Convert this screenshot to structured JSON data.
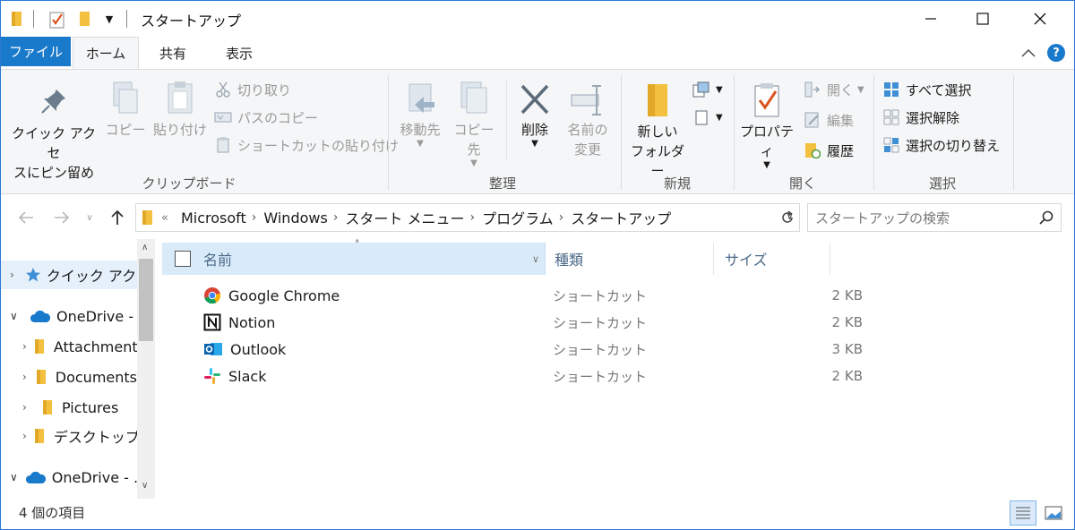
{
  "window": {
    "title": "スタートアップ"
  },
  "tabs": {
    "file": "ファイル",
    "home": "ホーム",
    "share": "共有",
    "view": "表示"
  },
  "ribbon": {
    "clipboard": {
      "label": "クリップボード",
      "pin_line1": "クイック アクセ",
      "pin_line2": "スにピン留め",
      "copy": "コピー",
      "paste": "貼り付け",
      "cut": "切り取り",
      "copy_path": "パスのコピー",
      "paste_shortcut": "ショートカットの貼り付け"
    },
    "organize": {
      "label": "整理",
      "move_to": "移動先",
      "copy_to": "コピー先",
      "delete": "削除",
      "rename_line1": "名前の",
      "rename_line2": "変更"
    },
    "new": {
      "label": "新規",
      "new_folder_line1": "新しい",
      "new_folder_line2": "フォルダー"
    },
    "open": {
      "label": "開く",
      "properties": "プロパティ",
      "open": "開く",
      "edit": "編集",
      "history": "履歴"
    },
    "select": {
      "label": "選択",
      "select_all": "すべて選択",
      "select_none": "選択解除",
      "invert": "選択の切り替え"
    }
  },
  "address": {
    "prefix": "«",
    "crumbs": [
      "Microsoft",
      "Windows",
      "スタート メニュー",
      "プログラム",
      "スタートアップ"
    ],
    "search_placeholder": "スタートアップの検索"
  },
  "navpane": {
    "quick_access": "クイック アクセス",
    "onedrive1": "OneDrive -",
    "attachments": "Attachments",
    "documents": "Documents",
    "pictures": "Pictures",
    "desktop": "デスクトップ",
    "onedrive2": "OneDrive - ..."
  },
  "columns": {
    "name": "名前",
    "type": "種類",
    "size": "サイズ"
  },
  "files": [
    {
      "name": "Google Chrome",
      "type": "ショートカット",
      "size": "2 KB",
      "icon": "chrome-icon"
    },
    {
      "name": "Notion",
      "type": "ショートカット",
      "size": "2 KB",
      "icon": "notion-icon"
    },
    {
      "name": "Outlook",
      "type": "ショートカット",
      "size": "3 KB",
      "icon": "outlook-icon"
    },
    {
      "name": "Slack",
      "type": "ショートカット",
      "size": "2 KB",
      "icon": "slack-icon"
    }
  ],
  "status": {
    "count": "4 個の項目"
  },
  "colors": {
    "accent": "#1979ca",
    "selection": "#cce4f7",
    "folder": "#f4c03f"
  }
}
